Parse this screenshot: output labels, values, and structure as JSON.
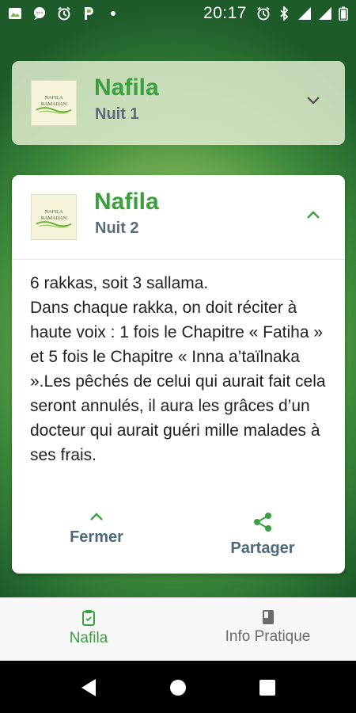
{
  "status_bar": {
    "time": "20:17",
    "left_icons": [
      "gallery-icon",
      "chat-icon",
      "alarm-icon",
      "parking-icon",
      "dot-icon"
    ],
    "right_icons": [
      "alarm-icon",
      "bluetooth-icon",
      "signal-icon",
      "signal-icon",
      "battery-icon"
    ]
  },
  "cards": [
    {
      "thumb_text": [
        "NAFILA",
        "RAMADAN"
      ],
      "title": "Nafila",
      "subtitle": "Nuit 1",
      "expanded": false
    },
    {
      "thumb_text": [
        "NAFILA",
        "RAMADAN"
      ],
      "title": "Nafila",
      "subtitle": "Nuit 2",
      "expanded": true,
      "body": "6 rakkas, soit 3 sallama.\nDans chaque rakka, on doit réciter à haute voix : 1 fois le Chapitre « Fatiha » et 5 fois le Chapitre « Inna a’taïlnaka ».Les pêchés de celui qui aurait fait cela seront annulés, il aura les grâces d’un docteur qui aurait guéri mille malades à ses frais.",
      "actions": {
        "close": "Fermer",
        "share": "Partager"
      }
    }
  ],
  "bottom_nav": {
    "items": [
      {
        "label": "Nafila",
        "icon": "clipboard-icon",
        "active": true
      },
      {
        "label": "Info Pratique",
        "icon": "book-icon",
        "active": false
      }
    ]
  },
  "colors": {
    "accent": "#3aa03e",
    "subtitle": "#5b6c7a",
    "action": "#4b6a7e"
  }
}
